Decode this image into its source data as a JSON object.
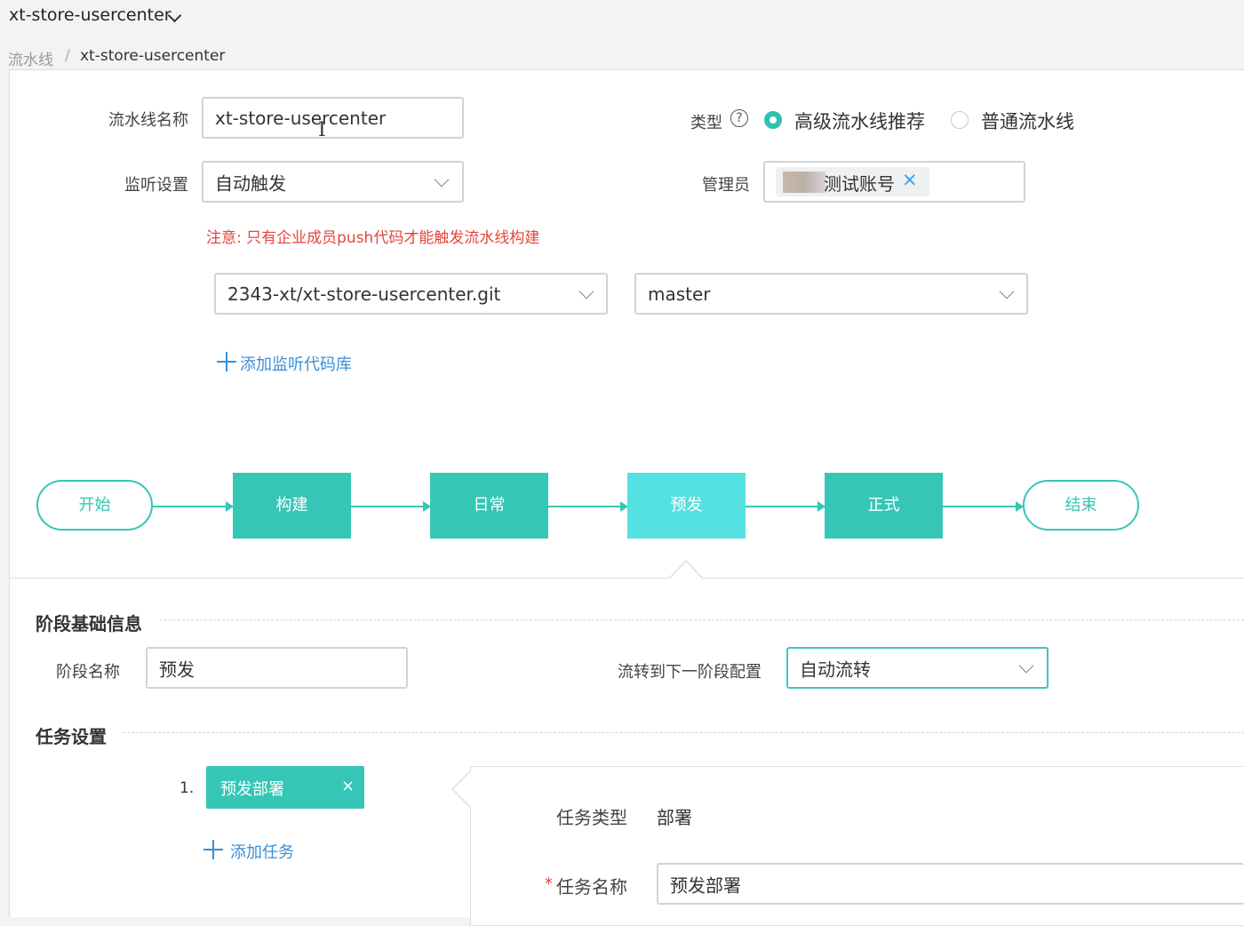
{
  "header": {
    "app_title": "xt-store-usercenter"
  },
  "breadcrumb": {
    "root": "流水线",
    "separator": "/",
    "current": "xt-store-usercenter"
  },
  "form": {
    "name_label": "流水线名称",
    "name_value": "xt-store-usercenter",
    "type_label": "类型",
    "type_help": "?",
    "type_options": [
      {
        "label": "高级流水线推荐",
        "selected": true
      },
      {
        "label": "普通流水线",
        "selected": false
      }
    ],
    "listen_label": "监听设置",
    "listen_value": "自动触发",
    "admin_label": "管理员",
    "admin_tag": "测试账号",
    "admin_tag_remove": "×",
    "note": "注意: 只有企业成员push代码才能触发流水线构建",
    "repo_value": "2343-xt/xt-store-usercenter.git",
    "branch_value": "master",
    "add_repo": "添加监听代码库"
  },
  "pipeline": {
    "start": "开始",
    "stages": [
      {
        "label": "构建",
        "active": false
      },
      {
        "label": "日常",
        "active": false
      },
      {
        "label": "预发",
        "active": true
      },
      {
        "label": "正式",
        "active": false
      }
    ],
    "end": "结束",
    "colors": {
      "stage": "#36c6b6",
      "active": "#55e0e1",
      "line": "#35c6b6"
    }
  },
  "stage_info": {
    "section_title": "阶段基础信息",
    "name_label": "阶段名称",
    "name_value": "预发",
    "flow_label": "流转到下一阶段配置",
    "flow_value": "自动流转"
  },
  "task_settings": {
    "section_title": "任务设置",
    "tasks": [
      {
        "index": "1.",
        "label": "预发部署",
        "remove": "×"
      }
    ],
    "add_task": "添加任务",
    "detail": {
      "type_label": "任务类型",
      "type_value": "部署",
      "required_mark": "*",
      "name_label": "任务名称",
      "name_value": "预发部署"
    }
  }
}
